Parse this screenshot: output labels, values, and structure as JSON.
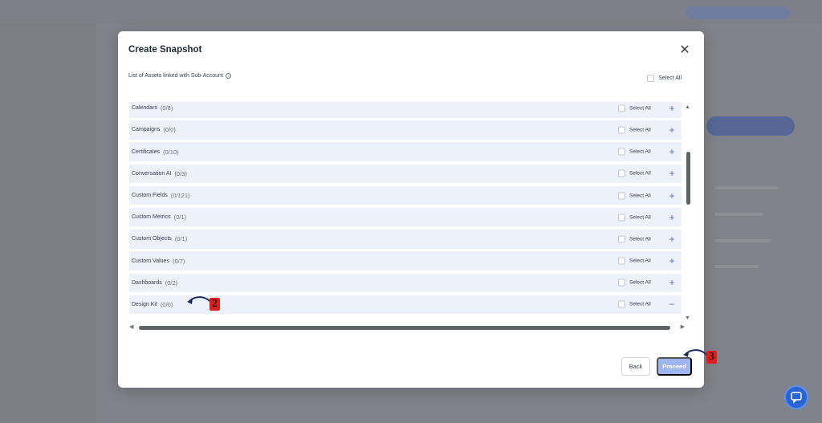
{
  "modal": {
    "title": "Create Snapshot",
    "subtitle": "List of Assets linked with Sub-Account",
    "select_all_label": "Select All",
    "close_icon": "close-icon",
    "info_icon": "info-icon"
  },
  "assets": [
    {
      "name": "Calendars",
      "count": "(0/8)",
      "select_label": "Select All",
      "expander": "+"
    },
    {
      "name": "Campaigns",
      "count": "(0/0)",
      "select_label": "Select All",
      "expander": "+"
    },
    {
      "name": "Certificates",
      "count": "(0/10)",
      "select_label": "Select All",
      "expander": "+"
    },
    {
      "name": "Conversation AI",
      "count": "(0/3)",
      "select_label": "Select All",
      "expander": "+"
    },
    {
      "name": "Custom Fields",
      "count": "(0/121)",
      "select_label": "Select All",
      "expander": "+"
    },
    {
      "name": "Custom Metrics",
      "count": "(0/1)",
      "select_label": "Select All",
      "expander": "+"
    },
    {
      "name": "Custom Objects",
      "count": "(0/1)",
      "select_label": "Select All",
      "expander": "+"
    },
    {
      "name": "Custom Values",
      "count": "(0/7)",
      "select_label": "Select All",
      "expander": "+"
    },
    {
      "name": "Dashboards",
      "count": "(0/2)",
      "select_label": "Select All",
      "expander": "+"
    },
    {
      "name": "Design Kit",
      "count": "(0/0)",
      "select_label": "Select All",
      "expander": "−"
    }
  ],
  "footer": {
    "back_label": "Back",
    "proceed_label": "Proceed"
  },
  "annotations": {
    "step_a": "2",
    "step_b": "3"
  },
  "colors": {
    "accent": "#4f6fd8",
    "row_bg": "#edf1fa",
    "proceed_bg": "#9fb5ef",
    "annotation_red": "#e31b1b"
  },
  "chat_icon": "chat-support-icon"
}
